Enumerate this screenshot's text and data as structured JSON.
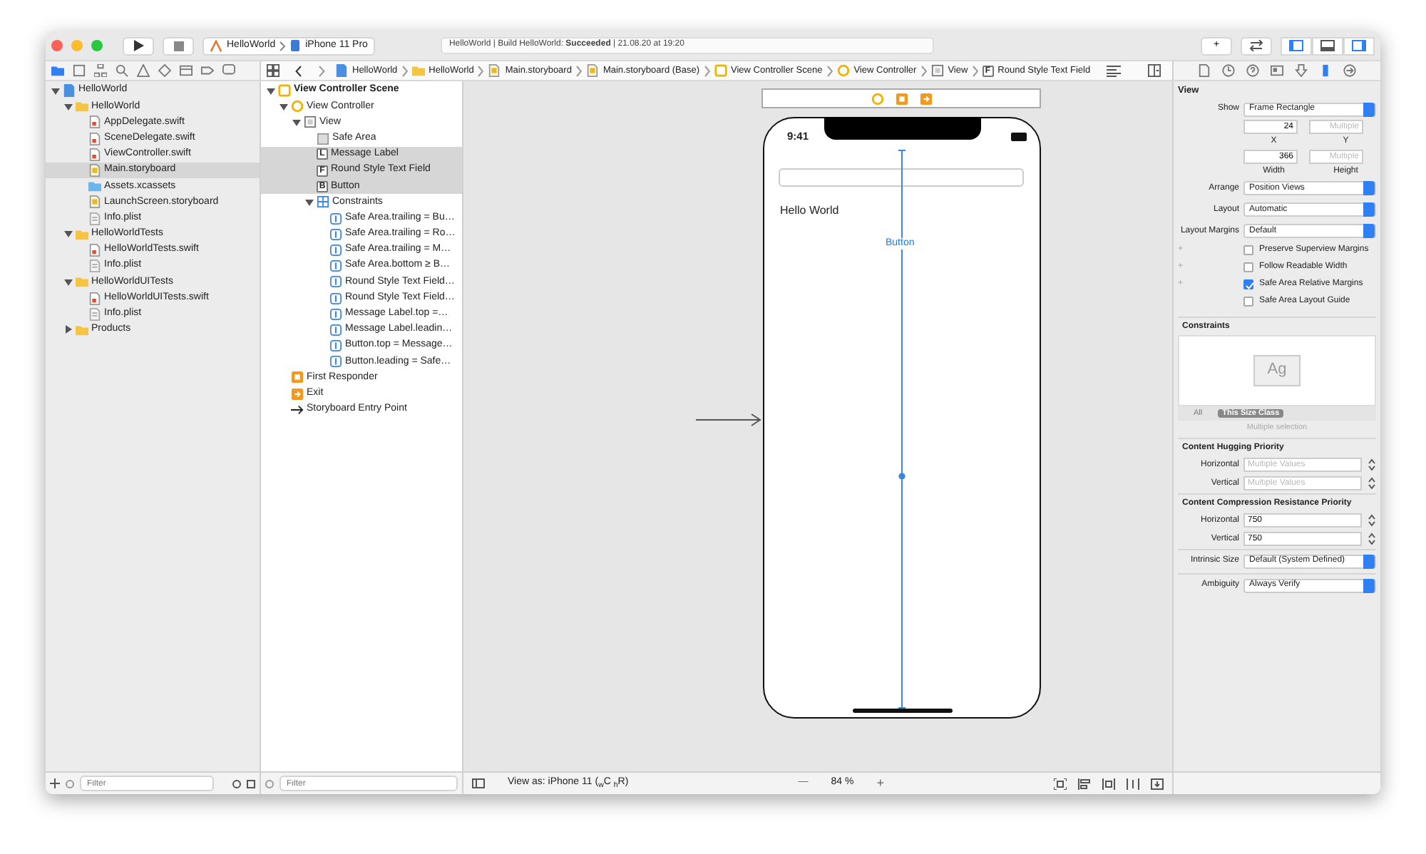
{
  "toolbar": {
    "scheme": {
      "project": "HelloWorld",
      "device": "iPhone 11 Pro"
    },
    "status": "HelloWorld | Build HelloWorld: **Succeeded** | 21.08.20 at 19:20",
    "library_button": "+",
    "panels": [
      {
        "kind": "navigator",
        "on": true
      },
      {
        "kind": "debug",
        "on": false
      },
      {
        "kind": "inspector",
        "on": true
      }
    ]
  },
  "navigator_tabs": [
    {
      "kind": "folder",
      "selected": true
    },
    {
      "kind": "square",
      "selected": false
    },
    {
      "kind": "hierarchy",
      "selected": false
    },
    {
      "kind": "search",
      "selected": false
    },
    {
      "kind": "warning",
      "selected": false
    },
    {
      "kind": "diamond",
      "selected": false
    },
    {
      "kind": "grid",
      "selected": false
    },
    {
      "kind": "tag",
      "selected": false
    },
    {
      "kind": "bubble",
      "selected": false
    }
  ],
  "jump_bar": [
    {
      "kind": "project",
      "label": "HelloWorld"
    },
    {
      "kind": "folder",
      "label": "HelloWorld"
    },
    {
      "kind": "storyboard",
      "label": "Main.storyboard"
    },
    {
      "kind": "storyboard",
      "label": "Main.storyboard (Base)"
    },
    {
      "kind": "scene",
      "label": "View Controller Scene"
    },
    {
      "kind": "controller",
      "label": "View Controller"
    },
    {
      "kind": "view",
      "label": "View"
    },
    {
      "kind": "glyph",
      "glyph": "F",
      "label": "Round Style Text Field"
    }
  ],
  "inspector_tabs": [
    {
      "kind": "document",
      "selected": false
    },
    {
      "kind": "clock",
      "selected": false
    },
    {
      "kind": "help",
      "selected": false
    },
    {
      "kind": "card",
      "selected": false
    },
    {
      "kind": "attributes",
      "selected": false
    },
    {
      "kind": "ruler",
      "selected": true
    },
    {
      "kind": "connections",
      "selected": false
    }
  ],
  "navigator": {
    "items": [
      {
        "kind": "project",
        "label": "HelloWorld",
        "selected": false,
        "expanded": true,
        "children": [
          {
            "kind": "folder",
            "label": "HelloWorld",
            "selected": false,
            "expanded": true,
            "children": [
              {
                "kind": "swift",
                "label": "AppDelegate.swift",
                "selected": false
              },
              {
                "kind": "swift",
                "label": "SceneDelegate.swift",
                "selected": false
              },
              {
                "kind": "swift",
                "label": "ViewController.swift",
                "selected": false
              },
              {
                "kind": "storyboard",
                "label": "Main.storyboard",
                "selected": true
              },
              {
                "kind": "assets",
                "label": "Assets.xcassets",
                "selected": false
              },
              {
                "kind": "storyboard",
                "label": "LaunchScreen.storyboard",
                "selected": false
              },
              {
                "kind": "plist",
                "label": "Info.plist",
                "selected": false
              }
            ]
          },
          {
            "kind": "folder",
            "label": "HelloWorldTests",
            "selected": false,
            "expanded": true,
            "children": [
              {
                "kind": "swift",
                "label": "HelloWorldTests.swift",
                "selected": false
              },
              {
                "kind": "plist",
                "label": "Info.plist",
                "selected": false
              }
            ]
          },
          {
            "kind": "folder",
            "label": "HelloWorldUITests",
            "selected": false,
            "expanded": true,
            "children": [
              {
                "kind": "swift",
                "label": "HelloWorldUITests.swift",
                "selected": false
              },
              {
                "kind": "plist",
                "label": "Info.plist",
                "selected": false
              }
            ]
          },
          {
            "kind": "folder",
            "label": "Products",
            "selected": false,
            "expanded": false
          }
        ]
      }
    ],
    "filter": {
      "placeholder": "Filter"
    }
  },
  "outline": {
    "items": [
      {
        "kind": "scene",
        "label": "View Controller Scene",
        "selected": false,
        "expanded": true,
        "children": [
          {
            "kind": "controller",
            "label": "View Controller",
            "selected": false,
            "expanded": true,
            "children": [
              {
                "kind": "view",
                "label": "View",
                "selected": false,
                "expanded": true,
                "children": [
                  {
                    "kind": "safe-area",
                    "label": "Safe Area",
                    "selected": false
                  },
                  {
                    "kind": "glyph",
                    "glyph": "L",
                    "label": "Message Label",
                    "selected": true
                  },
                  {
                    "kind": "glyph",
                    "glyph": "F",
                    "label": "Round Style Text Field",
                    "selected": true
                  },
                  {
                    "kind": "glyph",
                    "glyph": "B",
                    "label": "Button",
                    "selected": true
                  },
                  {
                    "kind": "constraints",
                    "label": "Constraints",
                    "selected": false,
                    "expanded": true,
                    "children": [
                      {
                        "kind": "constraint",
                        "label": "Safe Area.trailing = Bu…",
                        "selected": false
                      },
                      {
                        "kind": "constraint",
                        "label": "Safe Area.trailing = Ro…",
                        "selected": false
                      },
                      {
                        "kind": "constraint",
                        "label": "Safe Area.trailing = M…",
                        "selected": false
                      },
                      {
                        "kind": "constraint",
                        "label": "Safe Area.bottom ≥ B…",
                        "selected": false
                      },
                      {
                        "kind": "constraint",
                        "label": "Round Style Text Field…",
                        "selected": false
                      },
                      {
                        "kind": "constraint",
                        "label": "Round Style Text Field…",
                        "selected": false
                      },
                      {
                        "kind": "constraint",
                        "label": "Message Label.top =…",
                        "selected": false
                      },
                      {
                        "kind": "constraint",
                        "label": "Message Label.leadin…",
                        "selected": false
                      },
                      {
                        "kind": "constraint",
                        "label": "Button.top = Message…",
                        "selected": false
                      },
                      {
                        "kind": "constraint",
                        "label": "Button.leading = Safe…",
                        "selected": false
                      }
                    ]
                  }
                ]
              }
            ]
          },
          {
            "kind": "responder",
            "label": "First Responder",
            "selected": false
          },
          {
            "kind": "exit",
            "label": "Exit",
            "selected": false
          },
          {
            "kind": "entry",
            "label": "Storyboard Entry Point",
            "selected": false
          }
        ]
      }
    ],
    "filter": {
      "placeholder": "Filter"
    }
  },
  "canvas": {
    "scene_icons": [
      {
        "kind": "controller"
      },
      {
        "kind": "responder"
      },
      {
        "kind": "exit"
      }
    ],
    "phone": {
      "time": "9:41",
      "label": "Hello World",
      "button": "Button"
    }
  },
  "canvas_bar": {
    "view_as": "View as: iPhone 11 ($_{w}$C $_{h}$R)",
    "zoom_out": "—",
    "zoom": "84 %",
    "zoom_in": "+"
  },
  "inspector": {
    "title": "View",
    "show": {
      "label": "Show",
      "value": "Frame Rectangle"
    },
    "x": {
      "value": "24",
      "caption": "X"
    },
    "y": {
      "placeholder": "Multiple",
      "caption": "Y"
    },
    "width": {
      "value": "366",
      "caption": "Width"
    },
    "height": {
      "placeholder": "Multiple",
      "caption": "Height"
    },
    "popups": [
      {
        "label": "Arrange",
        "value": "Position Views"
      },
      {
        "label": "Layout",
        "value": "Automatic"
      },
      {
        "label": "Layout Margins",
        "value": "Default"
      }
    ],
    "checkboxes": [
      {
        "prefix": "+",
        "label": "Preserve Superview Margins",
        "checked": false
      },
      {
        "prefix": "+",
        "label": "Follow Readable Width",
        "checked": false
      },
      {
        "prefix": "+",
        "label": "Safe Area Relative Margins",
        "checked": true
      },
      {
        "label": "Safe Area Layout Guide",
        "checked": false
      }
    ],
    "constraints": {
      "title": "Constraints",
      "preview": "Ag",
      "tabs": [
        {
          "label": "All",
          "selected": false
        },
        {
          "label": "This Size Class",
          "selected": true
        }
      ],
      "note": "Multiple selection"
    },
    "hugging": {
      "title": "Content Hugging Priority",
      "rows": [
        {
          "label": "Horizontal",
          "placeholder": "Multiple Values"
        },
        {
          "label": "Vertical",
          "placeholder": "Multiple Values"
        }
      ]
    },
    "compression": {
      "title": "Content Compression Resistance Priority",
      "rows": [
        {
          "label": "Horizontal",
          "value": "750"
        },
        {
          "label": "Vertical",
          "value": "750"
        }
      ]
    },
    "intrinsic": {
      "label": "Intrinsic Size",
      "value": "Default (System Defined)"
    },
    "ambiguity": {
      "label": "Ambiguity",
      "value": "Always Verify"
    }
  }
}
